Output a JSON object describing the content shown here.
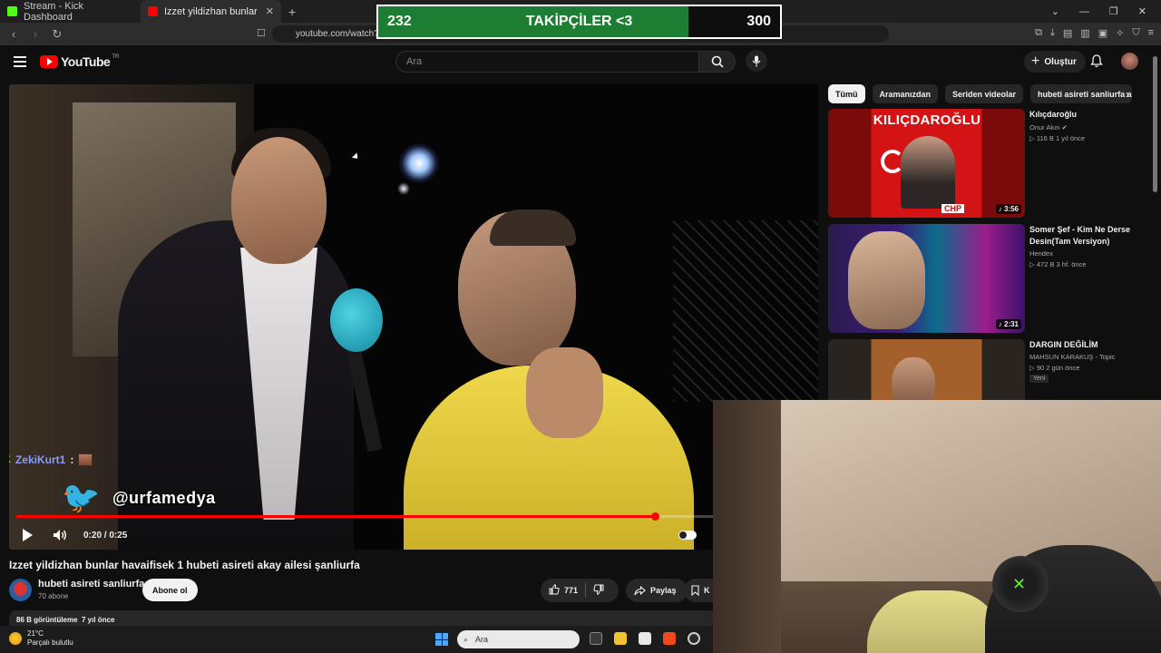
{
  "browser": {
    "tabs": [
      {
        "label": "Stream - Kick Dashboard",
        "fav_color": "#53fc18"
      },
      {
        "label": "Izzet yildizhan bunlar havaifisek",
        "fav_color": "#ff0000"
      }
    ],
    "url": "youtube.com/watch?v="
  },
  "overlay": {
    "current": "232",
    "label": "TAKİPÇİLER <3",
    "goal": "300",
    "progress": 0.773
  },
  "youtube": {
    "logo": "YouTube",
    "region": "TR",
    "search_placeholder": "Ara",
    "create_label": "Oluştur"
  },
  "player": {
    "watermark": "@urfamedya",
    "chat_user": "ZekiKurt1",
    "chat_sep": ":",
    "time": "0:20 / 0:25",
    "progress": 0.8
  },
  "video": {
    "title": "Izzet yildizhan bunlar havaifisek 1 hubeti asireti akay ailesi şanliurfa",
    "channel": "hubeti asireti sanliurfa",
    "subscribers": "70 abone",
    "subscribe_label": "Abone ol",
    "likes": "771",
    "share_label": "Paylaş",
    "more_label": "K",
    "views_date": "86 B görüntüleme  7 yıl önce"
  },
  "chips": [
    "Tümü",
    "Aramanızdan",
    "Seriden videolar",
    "hubeti asireti sanliurfa adlı g"
  ],
  "recommendations": [
    {
      "title": "Kılıçdaroğlu",
      "channel": "Onur Akın",
      "stats": "▷ 116 B   1 yıl önce",
      "duration": "♪ 3:56",
      "thumb_text": "KILIÇDAROĞLU",
      "thumb_tag": "CHP"
    },
    {
      "title": "Somer Şef - Kim Ne Derse Desin(Tam Versiyon)",
      "channel": "Hendex",
      "stats": "▷ 472 B   3 hf. önce",
      "duration": "♪ 2:31"
    },
    {
      "title": "DARGIN DEĞİLİM",
      "channel": "MAHSUN KARAKUŞ - Topic",
      "stats": "▷ 90   2 gün önce",
      "badge": "Yeni"
    }
  ],
  "taskbar": {
    "temp": "21°C",
    "weather": "Parçalı bulutlu",
    "search": "Ara"
  }
}
